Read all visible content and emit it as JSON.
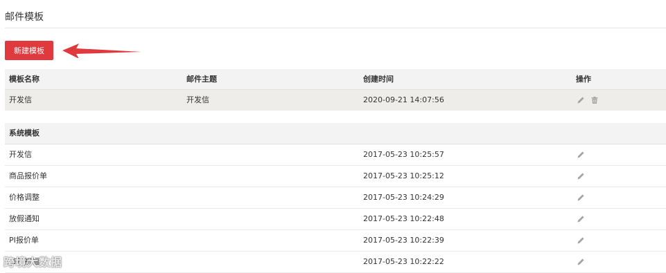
{
  "page": {
    "title": "邮件模板"
  },
  "toolbar": {
    "new_label": "新建模板"
  },
  "table": {
    "headers": {
      "name": "模板名称",
      "subject": "邮件主题",
      "created": "创建时间",
      "actions": "操作"
    },
    "custom_rows": [
      {
        "name": "开发信",
        "subject": "开发信",
        "created": "2020-09-21 14:07:56"
      }
    ]
  },
  "system": {
    "section_label": "系统模板",
    "rows": [
      {
        "name": "开发信",
        "created": "2017-05-23 10:25:57"
      },
      {
        "name": "商品报价单",
        "created": "2017-05-23 10:25:12"
      },
      {
        "name": "价格调整",
        "created": "2017-05-23 10:24:29"
      },
      {
        "name": "放假通知",
        "created": "2017-05-23 10:22:48"
      },
      {
        "name": "PI报价单",
        "created": "2017-05-23 10:22:39"
      },
      {
        "name": "节日祝福",
        "created": "2017-05-23 10:22:22"
      }
    ]
  },
  "watermark": {
    "text": "跨境大数据"
  },
  "icons": {
    "edit": "pencil-icon",
    "delete": "trash-icon",
    "annotation": "red-arrow-icon"
  },
  "colors": {
    "primary_button": "#e0393e",
    "header_bg": "#f3f3f3",
    "custom_row_bg": "#efede9",
    "icon": "#999999"
  }
}
